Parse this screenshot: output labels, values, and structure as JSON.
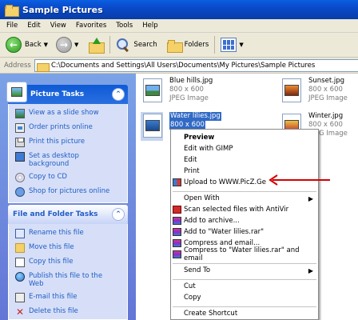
{
  "window": {
    "title": "Sample Pictures"
  },
  "menu": [
    "File",
    "Edit",
    "View",
    "Favorites",
    "Tools",
    "Help"
  ],
  "toolbar": {
    "back_label": "Back",
    "search_label": "Search",
    "folders_label": "Folders"
  },
  "address": {
    "label": "Address",
    "path": "C:\\Documents and Settings\\All Users\\Documents\\My Pictures\\Sample Pictures"
  },
  "picture_tasks": {
    "title": "Picture Tasks",
    "items": [
      {
        "label": "View as a slide show",
        "icon": "slideshow-icon"
      },
      {
        "label": "Order prints online",
        "icon": "order-prints-icon"
      },
      {
        "label": "Print this picture",
        "icon": "printer-icon"
      },
      {
        "label": "Set as desktop background",
        "icon": "desktop-icon"
      },
      {
        "label": "Copy to CD",
        "icon": "cd-icon"
      },
      {
        "label": "Shop for pictures online",
        "icon": "globe-icon"
      }
    ]
  },
  "file_folder_tasks": {
    "title": "File and Folder Tasks",
    "items": [
      {
        "label": "Rename this file",
        "icon": "rename-icon"
      },
      {
        "label": "Move this file",
        "icon": "move-icon"
      },
      {
        "label": "Copy this file",
        "icon": "copy-icon"
      },
      {
        "label": "Publish this file to the Web",
        "icon": "publish-web-icon"
      },
      {
        "label": "E-mail this file",
        "icon": "email-icon"
      },
      {
        "label": "Delete this file",
        "icon": "delete-icon"
      }
    ]
  },
  "files": [
    {
      "name": "Blue hills.jpg",
      "dims": "800 x 600",
      "type": "JPEG Image"
    },
    {
      "name": "Sunset.jpg",
      "dims": "800 x 600",
      "type": "JPEG Image"
    },
    {
      "name": "Water lilies.jpg",
      "dims": "800 x 600",
      "type": "",
      "selected": true
    },
    {
      "name": "Winter.jpg",
      "dims": "800 x 600",
      "type": "JPEG Image"
    }
  ],
  "context_menu": {
    "items": [
      {
        "label": "Preview"
      },
      {
        "label": "Edit with GIMP"
      },
      {
        "label": "Edit"
      },
      {
        "label": "Print"
      },
      {
        "label": "Upload to WWW.PicZ.Ge"
      },
      {
        "label": "Open With"
      },
      {
        "label": "Scan selected files with AntiVir"
      },
      {
        "label": "Add to archive..."
      },
      {
        "label": "Add to \"Water lilies.rar\""
      },
      {
        "label": "Compress and email..."
      },
      {
        "label": "Compress to \"Water lilies.rar\" and email"
      },
      {
        "label": "Send To"
      },
      {
        "label": "Cut"
      },
      {
        "label": "Copy"
      },
      {
        "label": "Create Shortcut"
      }
    ]
  },
  "colors": {
    "titlebar": "#0a49c9",
    "selection": "#316ac5",
    "task_link": "#215dc6",
    "annotation_arrow": "#d40000"
  }
}
